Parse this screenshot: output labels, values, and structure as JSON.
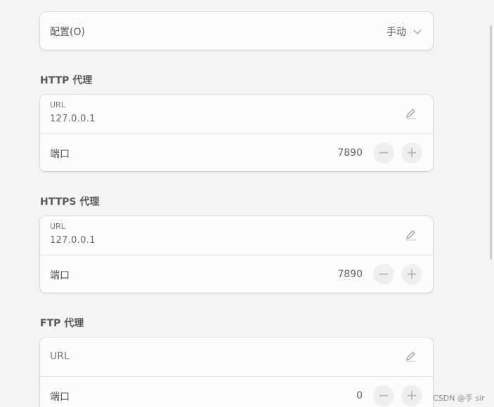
{
  "config": {
    "label": "配置(O)",
    "value": "手动"
  },
  "http": {
    "title": "HTTP 代理",
    "url_label": "URL",
    "url_value": "127.0.0.1",
    "port_label": "端口",
    "port_value": "7890",
    "minus": "−",
    "plus": "+"
  },
  "https": {
    "title": "HTTPS 代理",
    "url_label": "URL",
    "url_value": "127.0.0.1",
    "port_label": "端口",
    "port_value": "7890",
    "minus": "−",
    "plus": "+"
  },
  "ftp": {
    "title": "FTP 代理",
    "url_placeholder": "URL",
    "port_label": "端口",
    "port_value": "0",
    "minus": "−",
    "plus": "+"
  },
  "watermark": "CSDN @手 sir",
  "icons": {
    "edit": "edit-pencil-icon",
    "chevron": "chevron-down-icon",
    "minus": "minus-icon",
    "plus": "plus-icon"
  },
  "colors": {
    "background": "#f4f4f3",
    "card": "#fcfcfb",
    "text": "#555555",
    "button": "#efefed"
  }
}
